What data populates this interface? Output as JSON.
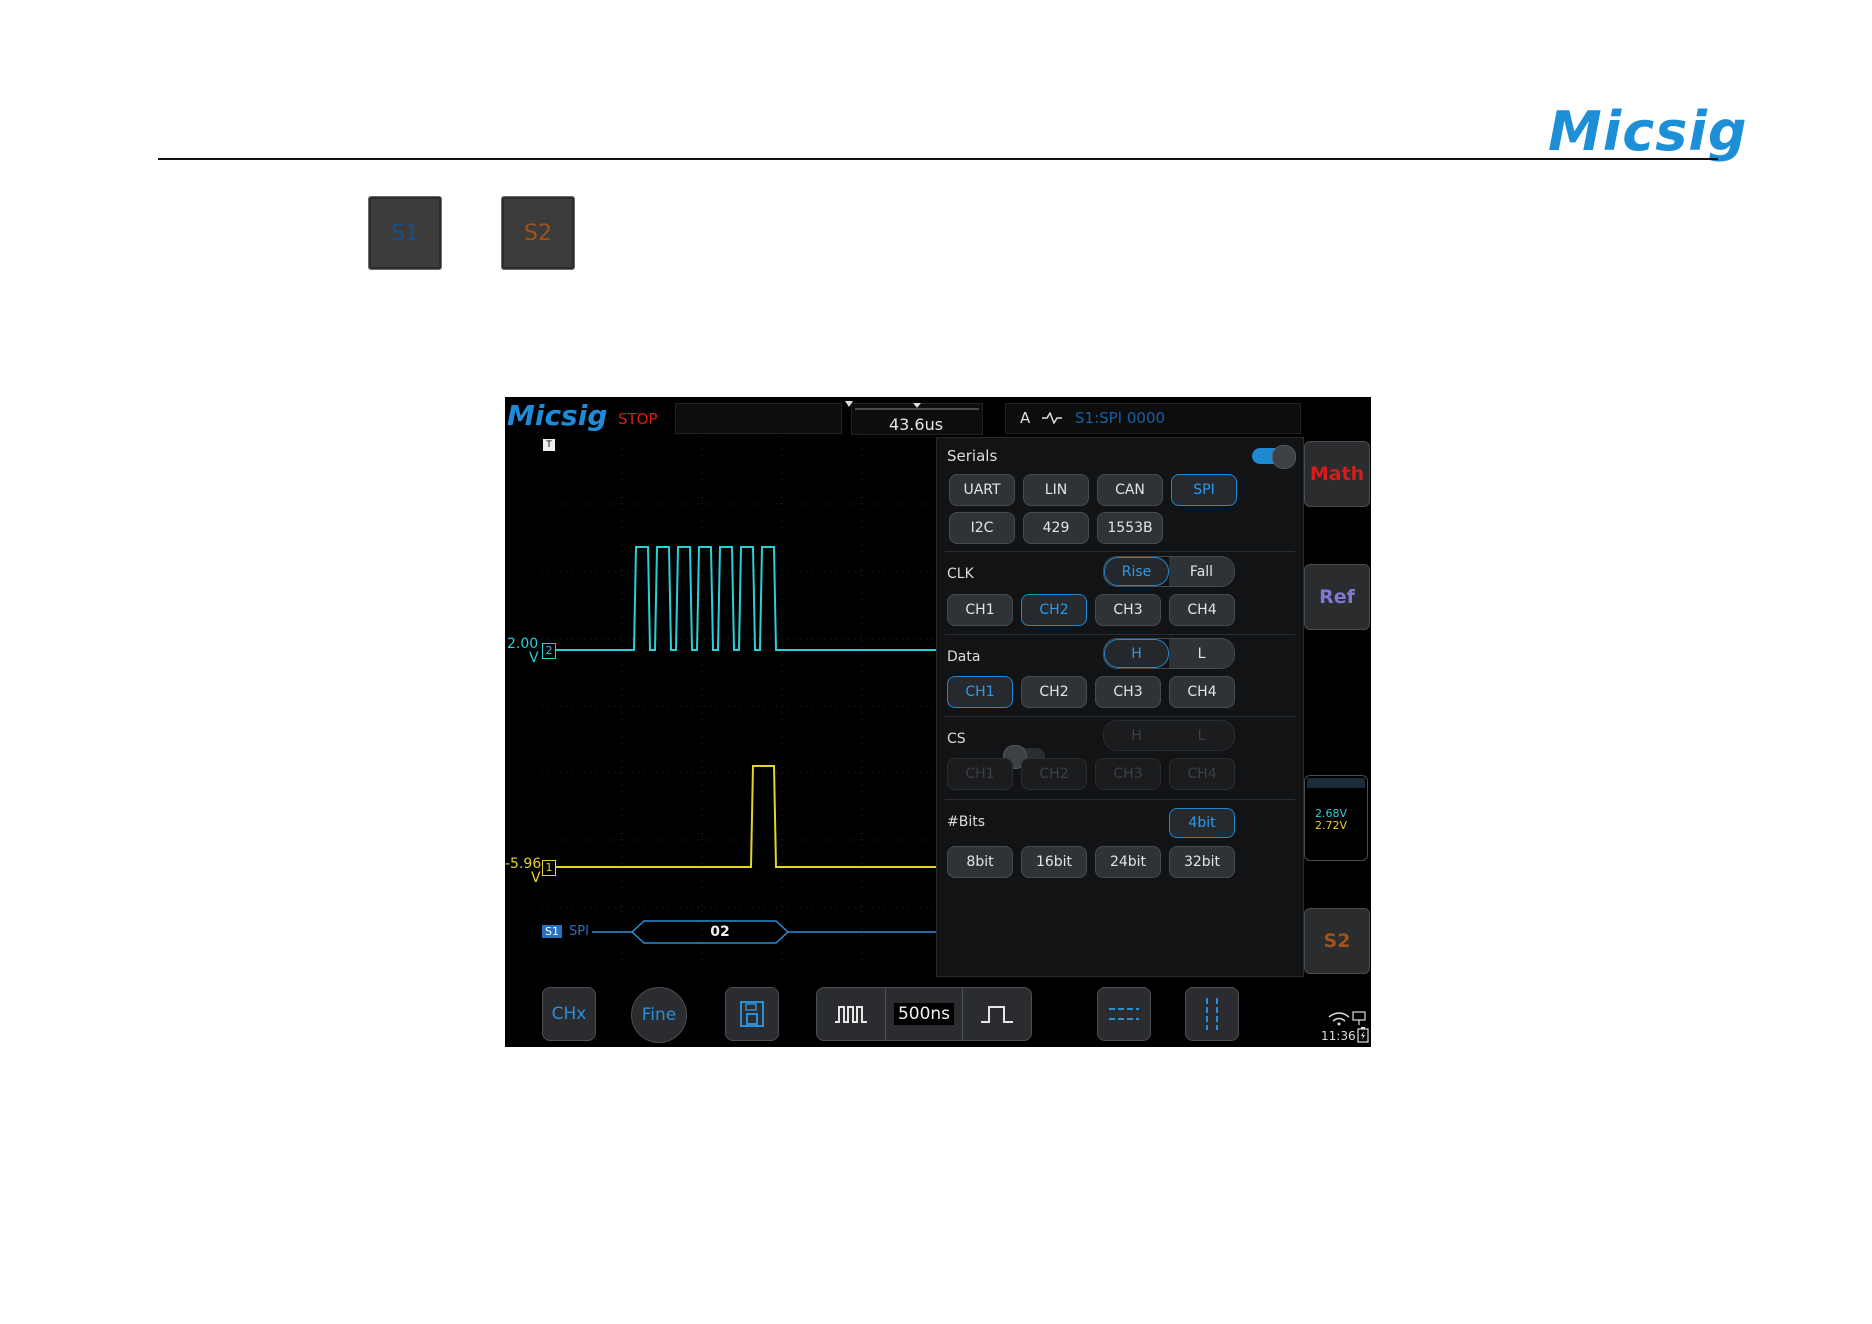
{
  "document": {
    "brand": "Micsig",
    "keys": [
      {
        "label": "S1",
        "color": "#1a4f85"
      },
      {
        "label": "S2",
        "color": "#a0521a"
      }
    ]
  },
  "scope": {
    "brand": "Micsig",
    "run_state": "STOP",
    "timebase_offset": "43.6us",
    "trigger": {
      "mode": "A",
      "source": "S1:SPI",
      "value": "0000"
    },
    "ch2": {
      "level": "2.00",
      "unit": "V",
      "marker": "2"
    },
    "ch1": {
      "level": "-5.96",
      "unit": "V",
      "marker": "1"
    },
    "decode": {
      "bus_marker": "S1",
      "bus_name": "SPI",
      "value": "02"
    },
    "serials_panel": {
      "title": "Serials",
      "enabled": true,
      "protocols_row1": [
        "UART",
        "LIN",
        "CAN",
        "SPI"
      ],
      "protocols_row2": [
        "I2C",
        "429",
        "1553B"
      ],
      "selected_protocol": "SPI",
      "clk": {
        "label": "CLK",
        "edge_options": [
          "Rise",
          "Fall"
        ],
        "edge": "Rise",
        "channels": [
          "CH1",
          "CH2",
          "CH3",
          "CH4"
        ],
        "selected": "CH2"
      },
      "data": {
        "label": "Data",
        "level_options": [
          "H",
          "L"
        ],
        "level": "H",
        "channels": [
          "CH1",
          "CH2",
          "CH3",
          "CH4"
        ],
        "selected": "CH1"
      },
      "cs": {
        "label": "CS",
        "enabled": false,
        "level_options": [
          "H",
          "L"
        ],
        "channels": [
          "CH1",
          "CH2",
          "CH3",
          "CH4"
        ]
      },
      "bits": {
        "label": "#Bits",
        "options": [
          "4bit",
          "8bit",
          "16bit",
          "24bit",
          "32bit"
        ],
        "selected": "4bit"
      }
    },
    "side_keys": {
      "math": "Math",
      "ref": "Ref",
      "s2": "S2"
    },
    "meter": {
      "ch1": "2.68V",
      "ch2": "2.72V"
    },
    "bottom": {
      "chx": "CHx",
      "fine": "Fine",
      "timebase": "500ns"
    },
    "status": {
      "time": "11:36"
    }
  }
}
